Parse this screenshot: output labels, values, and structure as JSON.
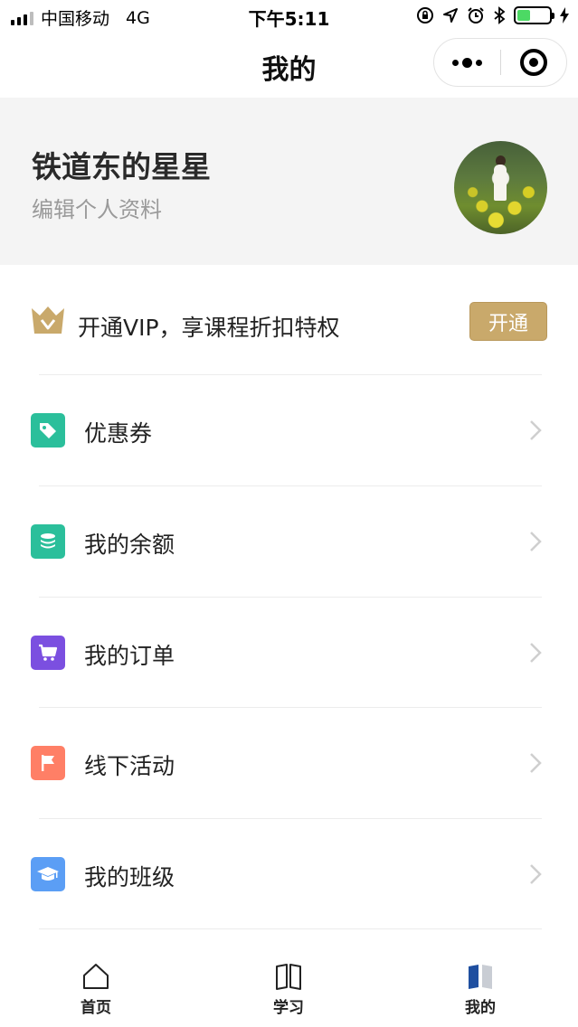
{
  "status_bar": {
    "carrier": "中国移动",
    "network": "4G",
    "time": "下午5:11"
  },
  "nav": {
    "title": "我的"
  },
  "profile": {
    "name": "铁道东的星星",
    "edit_label": "编辑个人资料"
  },
  "vip": {
    "text": "开通VIP，享课程折扣特权",
    "button_label": "开通",
    "accent_color": "#c9a96b"
  },
  "menu": [
    {
      "label": "优惠券",
      "icon": "tag-icon",
      "color": "#2bbf9b"
    },
    {
      "label": "我的余额",
      "icon": "database-coins-icon",
      "color": "#2bbf9b"
    },
    {
      "label": "我的订单",
      "icon": "shopping-cart-icon",
      "color": "#7b4fe0"
    },
    {
      "label": "线下活动",
      "icon": "flag-icon",
      "color": "#ff7f66"
    },
    {
      "label": "我的班级",
      "icon": "graduation-cap-icon",
      "color": "#5b9ef5"
    }
  ],
  "tabs": [
    {
      "label": "首页",
      "icon": "home-icon",
      "active": false
    },
    {
      "label": "学习",
      "icon": "book-icon",
      "active": false
    },
    {
      "label": "我的",
      "icon": "profile-book-icon",
      "active": true
    }
  ]
}
